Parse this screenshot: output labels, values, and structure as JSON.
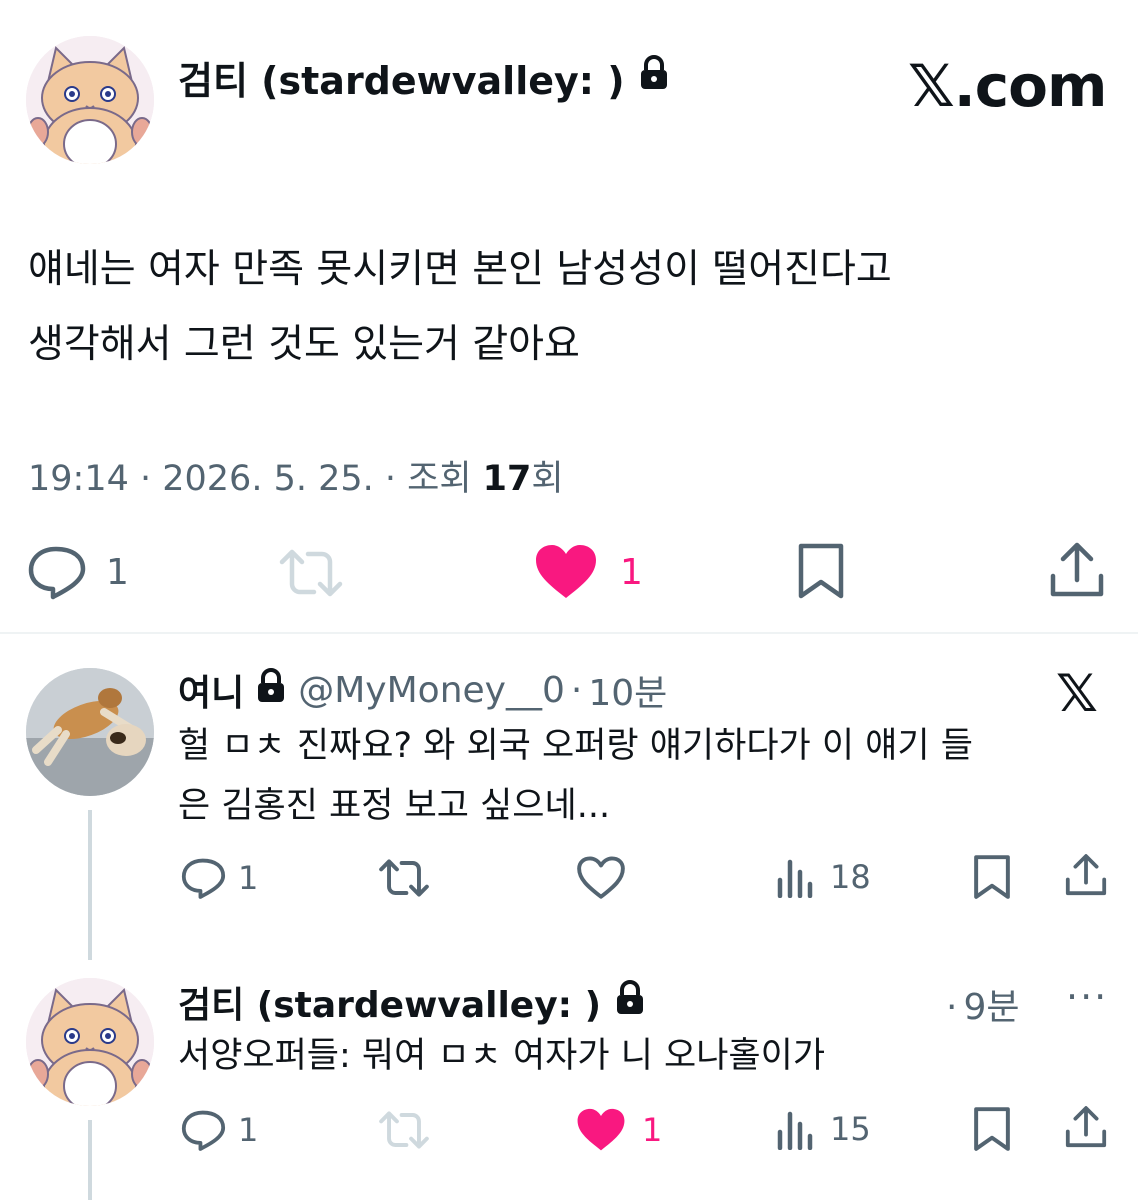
{
  "colors": {
    "like_active": "#f91880",
    "icon_gray": "#536471",
    "retweet_muted": "#cfd9de",
    "text": "#0f1419"
  },
  "main_tweet": {
    "author_name": "검티 (stardewvalley: )",
    "lock_icon": "lock-icon",
    "site_logo": "𝕏.com",
    "text_line1": "얘네는 여자 만족 못시키면 본인 남성성이 떨어진다고",
    "text_line2": "생각해서 그런 것도 있는거 같아요",
    "time": "19:14 · 2026. 5. 25. · 조회 ",
    "views": "17",
    "views_suffix": "회",
    "reply_count": "1",
    "like_count": "1",
    "liked": true,
    "retweet_enabled": false
  },
  "replies": [
    {
      "author_name": "여니",
      "handle": "@MyMoney__0",
      "time": "10분",
      "platform_icon": "𝕏",
      "text_line1": "헐 ㅁㅊ 진짜요? 와 외국 오퍼랑 얘기하다가 이 얘기 들",
      "text_line2": "은 김홍진 표정 보고 싶으네...",
      "reply_count": "1",
      "views": "18",
      "liked": false
    },
    {
      "author_name": "검티 (stardewvalley: )",
      "time": "9분",
      "more": "···",
      "text_line1": "서양오퍼들: 뭐여 ㅁㅊ 여자가 니 오나홀이가",
      "reply_count": "1",
      "like_count": "1",
      "views": "15",
      "liked": true
    }
  ]
}
